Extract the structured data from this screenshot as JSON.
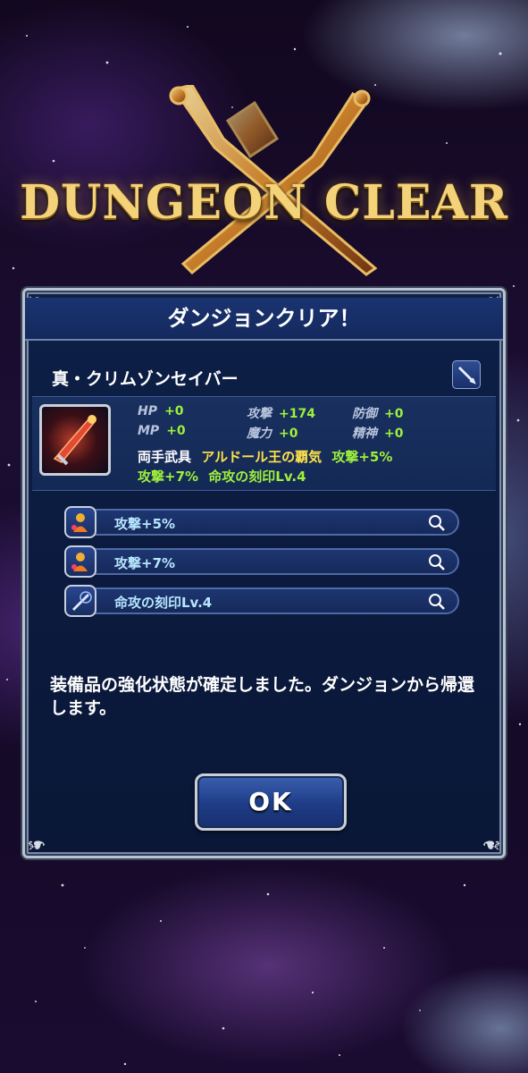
{
  "logo": {
    "text": "DUNGEON CLEAR"
  },
  "dialog": {
    "title": "ダンジョンクリア！",
    "item_name": "真・クリムゾンセイバー",
    "type_icon": "sword-icon",
    "stats": [
      {
        "label": "HP",
        "value": "+0"
      },
      {
        "label": "攻撃",
        "value": "+174"
      },
      {
        "label": "防御",
        "value": "+0"
      },
      {
        "label": "MP",
        "value": "+0"
      },
      {
        "label": "魔力",
        "value": "+0"
      },
      {
        "label": "精神",
        "value": "+0"
      }
    ],
    "category": "両手武具",
    "passive_name": "アルドール王の覇気",
    "passive_effect": "攻撃+5%",
    "line2_a": "攻撃+7%",
    "line2_b": "命攻の刻印Lv.4",
    "abilities": [
      {
        "label": "攻撃+5%",
        "icon": "attack-up-icon"
      },
      {
        "label": "攻撃+7%",
        "icon": "attack-up-icon"
      },
      {
        "label": "命攻の刻印Lv.4",
        "icon": "sword-seal-icon"
      }
    ],
    "message": "装備品の強化状態が確定しました。ダンジョンから帰還します。",
    "ok_label": "OK"
  },
  "colors": {
    "accent_green": "#9ef03c",
    "gold": "#f3d27a",
    "panel": "#0e2048"
  }
}
